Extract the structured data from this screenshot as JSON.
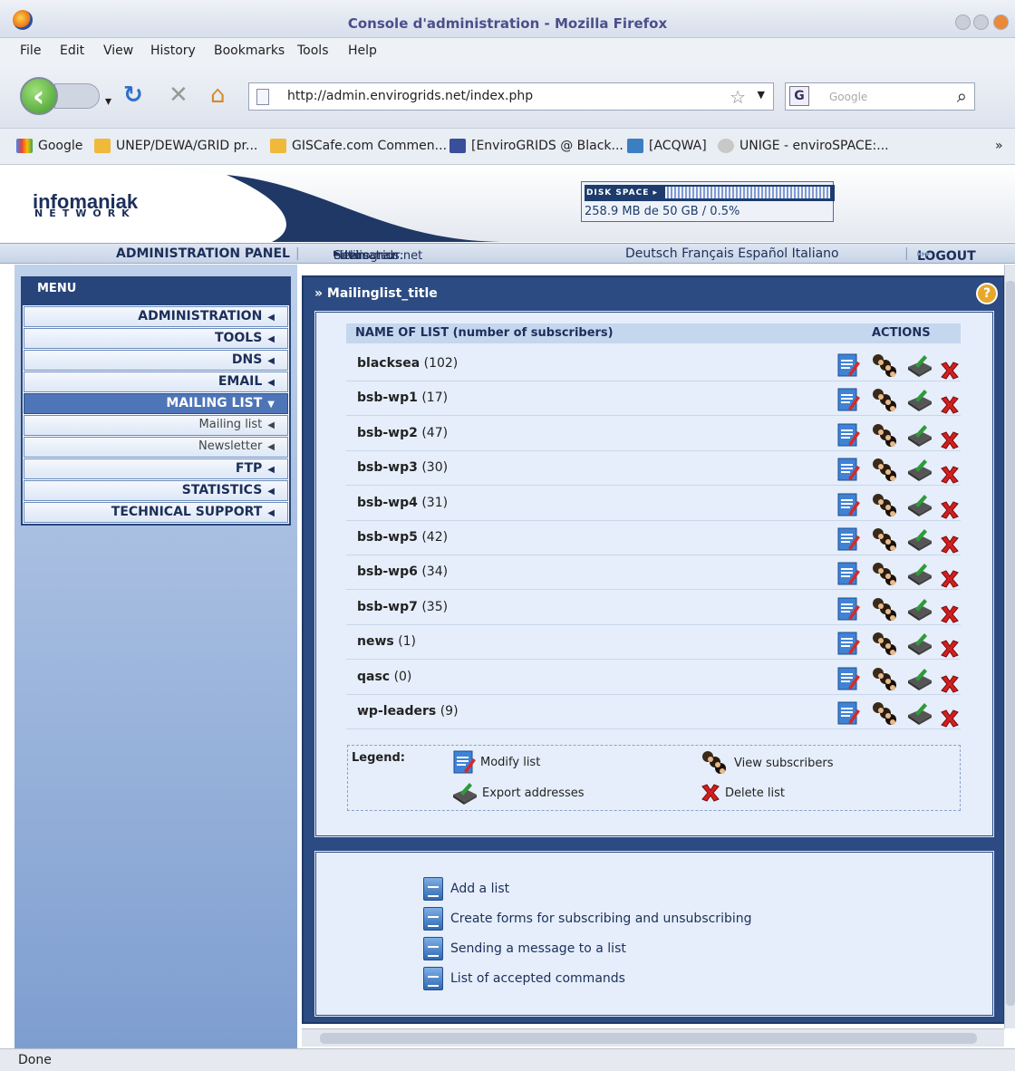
{
  "window": {
    "title": "Console d'administration - Mozilla Firefox"
  },
  "menubar": [
    "File",
    "Edit",
    "View",
    "History",
    "Bookmarks",
    "Tools",
    "Help"
  ],
  "nav": {
    "url": "http://admin.envirogrids.net/index.php",
    "search_placeholder": "Google",
    "search_engine_letter": "G"
  },
  "bookmarks": [
    "Google",
    "UNEP/DEWA/GRID pr...",
    "GISCafe.com Commen...",
    "[EnviroGRIDS @ Black...",
    "[ACQWA]",
    "UNIGE - enviroSPACE:..."
  ],
  "bookmarks_more": "»",
  "header": {
    "logo": "infomaniak",
    "logo_sub": "NETWORK",
    "disk_label": "DISK SPACE",
    "disk_usage_text": "258.9 MB de 50 GB / 0.5%",
    "disk_fraction": 0.005
  },
  "adminbar": {
    "panel": "ADMINISTRATION PANEL",
    "site_label": "Site:",
    "site": "envirogrids.net",
    "user_label": "Utilisateur:",
    "user": "lehmanan",
    "languages": "Deutsch Français Español Italiano",
    "logout": "LOGOUT"
  },
  "menu": {
    "title": "MENU",
    "items": [
      {
        "label": "ADMINISTRATION",
        "type": "main"
      },
      {
        "label": "TOOLS",
        "type": "main"
      },
      {
        "label": "DNS",
        "type": "main"
      },
      {
        "label": "EMAIL",
        "type": "main"
      },
      {
        "label": "MAILING LIST",
        "type": "active"
      },
      {
        "label": "Mailing list",
        "type": "sub"
      },
      {
        "label": "Newsletter",
        "type": "sub"
      },
      {
        "label": "FTP",
        "type": "main"
      },
      {
        "label": "STATISTICS",
        "type": "main"
      },
      {
        "label": "TECHNICAL SUPPORT",
        "type": "main"
      }
    ]
  },
  "content": {
    "title": "Mailinglist_title",
    "help": "?",
    "col_name": "NAME OF LIST (number of subscribers)",
    "col_actions": "ACTIONS",
    "lists": [
      {
        "name": "blacksea",
        "count": "(102)"
      },
      {
        "name": "bsb-wp1",
        "count": "(17)"
      },
      {
        "name": "bsb-wp2",
        "count": "(47)"
      },
      {
        "name": "bsb-wp3",
        "count": "(30)"
      },
      {
        "name": "bsb-wp4",
        "count": "(31)"
      },
      {
        "name": "bsb-wp5",
        "count": "(42)"
      },
      {
        "name": "bsb-wp6",
        "count": "(34)"
      },
      {
        "name": "bsb-wp7",
        "count": "(35)"
      },
      {
        "name": "news",
        "count": "(1)"
      },
      {
        "name": "qasc",
        "count": "(0)"
      },
      {
        "name": "wp-leaders",
        "count": "(9)"
      }
    ],
    "legend": {
      "label": "Legend:",
      "modify": "Modify list",
      "view": "View subscribers",
      "export": "Export addresses",
      "delete": "Delete list"
    },
    "links": [
      "Add a list",
      "Create forms for subscribing and unsubscribing",
      "Sending a message to a list",
      "List of accepted commands"
    ]
  },
  "status": "Done"
}
